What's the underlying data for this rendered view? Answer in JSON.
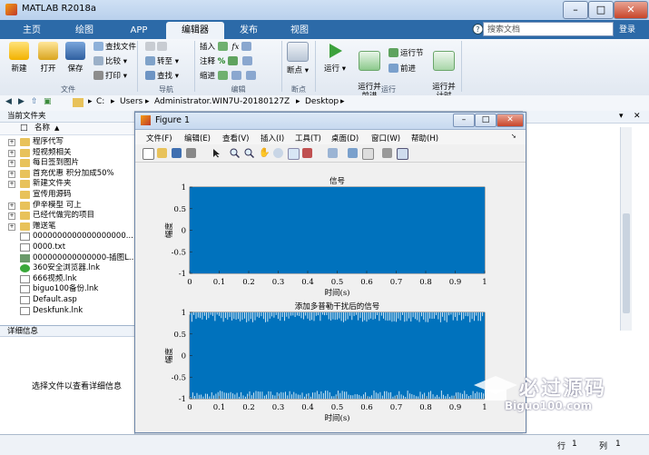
{
  "window": {
    "title": "MATLAB R2018a"
  },
  "tabs": [
    {
      "label": "主页"
    },
    {
      "label": "绘图"
    },
    {
      "label": "APP"
    },
    {
      "label": "编辑器"
    },
    {
      "label": "发布"
    },
    {
      "label": "视图"
    }
  ],
  "search": {
    "placeholder": "搜索文档"
  },
  "login_label": "登录",
  "ribbon": {
    "file": {
      "group": "文件",
      "new": "新建",
      "open": "打开",
      "save": "保存",
      "find_files": "查找文件",
      "compare": "比较",
      "print": "打印"
    },
    "navigate": {
      "group": "导航",
      "goto": "转至",
      "find": "查找"
    },
    "edit": {
      "group": "编辑",
      "insert": "插入",
      "comment": "注释",
      "indent": "缩进"
    },
    "breakpoints": {
      "group": "断点",
      "label": "断点"
    },
    "run": {
      "group": "运行",
      "run": "运行",
      "run_advance": "运行并\n前进",
      "run_section": "运行节",
      "advance": "前进",
      "run_time": "运行并\n计时"
    }
  },
  "address": {
    "drive": "C:",
    "path": [
      "Users",
      "Administrator.WIN7U-20180127Z",
      "Desktop"
    ]
  },
  "current_folder": {
    "title": "当前文件夹",
    "column_header": "名称",
    "items": [
      {
        "name": "程序代写",
        "type": "folder"
      },
      {
        "name": "短视频相关",
        "type": "folder"
      },
      {
        "name": "每日签到图片",
        "type": "folder"
      },
      {
        "name": "首充优惠 积分加成50%",
        "type": "folder"
      },
      {
        "name": "新建文件夹",
        "type": "folder"
      },
      {
        "name": "宣传用源码",
        "type": "folder-plain"
      },
      {
        "name": "伊辛模型 可上",
        "type": "folder"
      },
      {
        "name": "已经代做完的项目",
        "type": "folder"
      },
      {
        "name": "赠送笔",
        "type": "folder"
      },
      {
        "name": "0000000000000000000...",
        "type": "file"
      },
      {
        "name": "0000.txt",
        "type": "file"
      },
      {
        "name": "000000000000000-插图L...",
        "type": "image"
      },
      {
        "name": "360安全浏览器.lnk",
        "type": "lnk-green"
      },
      {
        "name": "666视频.lnk",
        "type": "lnk"
      },
      {
        "name": "biguo100备份.lnk",
        "type": "lnk"
      },
      {
        "name": "Default.asp",
        "type": "file"
      },
      {
        "name": "Deskfunk.lnk",
        "type": "lnk"
      }
    ]
  },
  "details": {
    "title": "详细信息",
    "hint": "选择文件以查看详细信息"
  },
  "statusbar": {
    "row_label": "行",
    "row_value": "1",
    "col_label": "列",
    "col_value": "1"
  },
  "figure": {
    "title": "Figure 1",
    "menu": [
      "文件(F)",
      "编辑(E)",
      "查看(V)",
      "插入(I)",
      "工具(T)",
      "桌面(D)",
      "窗口(W)",
      "帮助(H)"
    ]
  },
  "chart_data": [
    {
      "type": "line",
      "title": "信号",
      "xlabel": "时间(s)",
      "ylabel": "幅度",
      "xlim": [
        0,
        1
      ],
      "ylim": [
        -1,
        1
      ],
      "xticks": [
        "0",
        "0.1",
        "0.2",
        "0.3",
        "0.4",
        "0.5",
        "0.6",
        "0.7",
        "0.8",
        "0.9",
        "1"
      ],
      "yticks": [
        "1",
        "0.5",
        "0",
        "-0.5",
        "-1"
      ],
      "series": [
        {
          "description": "dense oscillation filling [-1,1]",
          "min": -1,
          "max": 1
        }
      ],
      "color": "#0072bd"
    },
    {
      "type": "line",
      "title": "添加多普勒干扰后的信号",
      "xlabel": "时间(s)",
      "ylabel": "幅度",
      "xlim": [
        0,
        1
      ],
      "ylim": [
        -1,
        1
      ],
      "xticks": [
        "0",
        "0.1",
        "0.2",
        "0.3",
        "0.4",
        "0.5",
        "0.6",
        "0.7",
        "0.8",
        "0.9",
        "1"
      ],
      "yticks": [
        "1",
        "0.5",
        "0",
        "-0.5",
        "-1"
      ],
      "series": [
        {
          "description": "dense oscillation with doppler interference",
          "min": -1,
          "max": 1
        }
      ],
      "color": "#0072bd"
    }
  ],
  "watermark": {
    "text_cn": "必过源码",
    "text_en": "Biguo100.com"
  }
}
